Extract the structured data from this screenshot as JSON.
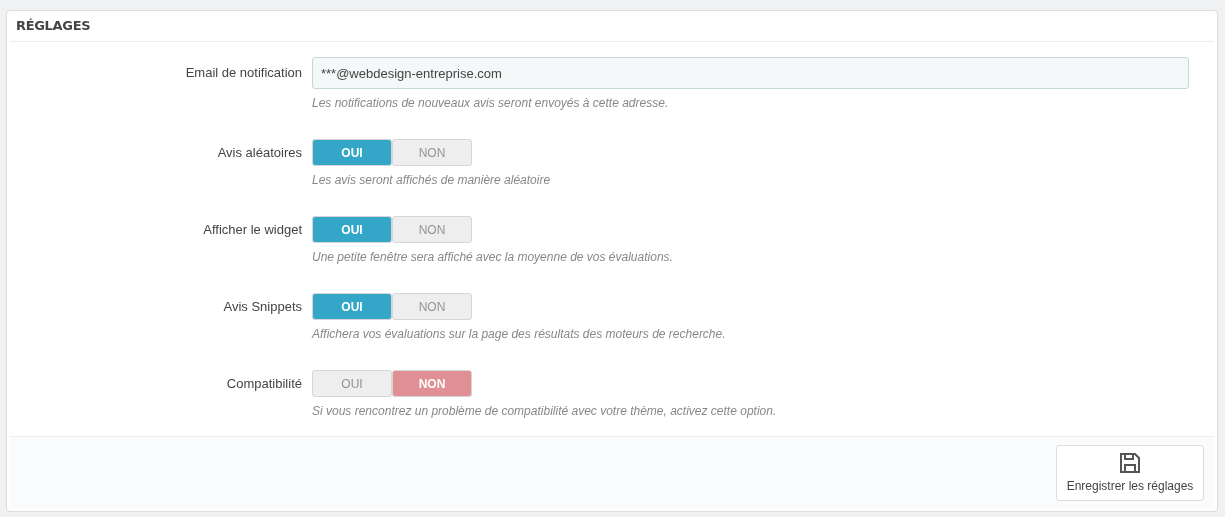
{
  "panel": {
    "title": "RÉGLAGES"
  },
  "email": {
    "label": "Email de notification",
    "value": "***@webdesign-entreprise.com",
    "help": "Les notifications de nouveaux avis seront envoyés à cette adresse."
  },
  "toggles": [
    {
      "label": "Avis aléatoires",
      "help": "Les avis seront affichés de manière aléatoire",
      "options": [
        {
          "label": "OUI",
          "kind": "yes",
          "selected": true
        },
        {
          "label": "NON",
          "kind": "no",
          "selected": false
        }
      ]
    },
    {
      "label": "Afficher le widget",
      "help": "Une petite fenêtre sera affiché avec la moyenne de vos évaluations.",
      "options": [
        {
          "label": "OUI",
          "kind": "yes",
          "selected": true
        },
        {
          "label": "NON",
          "kind": "no",
          "selected": false
        }
      ]
    },
    {
      "label": "Avis Snippets",
      "help": "Affichera vos évaluations sur la page des résultats des moteurs de recherche.",
      "options": [
        {
          "label": "OUI",
          "kind": "yes",
          "selected": true
        },
        {
          "label": "NON",
          "kind": "no",
          "selected": false
        }
      ]
    },
    {
      "label": "Compatibilité",
      "help": "Si vous rencontrez un problème de compatibilité avec votre thème, activez cette option.",
      "options": [
        {
          "label": "OUI",
          "kind": "yes",
          "selected": false
        },
        {
          "label": "NON",
          "kind": "no",
          "selected": true
        }
      ]
    }
  ],
  "footer": {
    "save_button": "Enregistrer les réglages"
  }
}
